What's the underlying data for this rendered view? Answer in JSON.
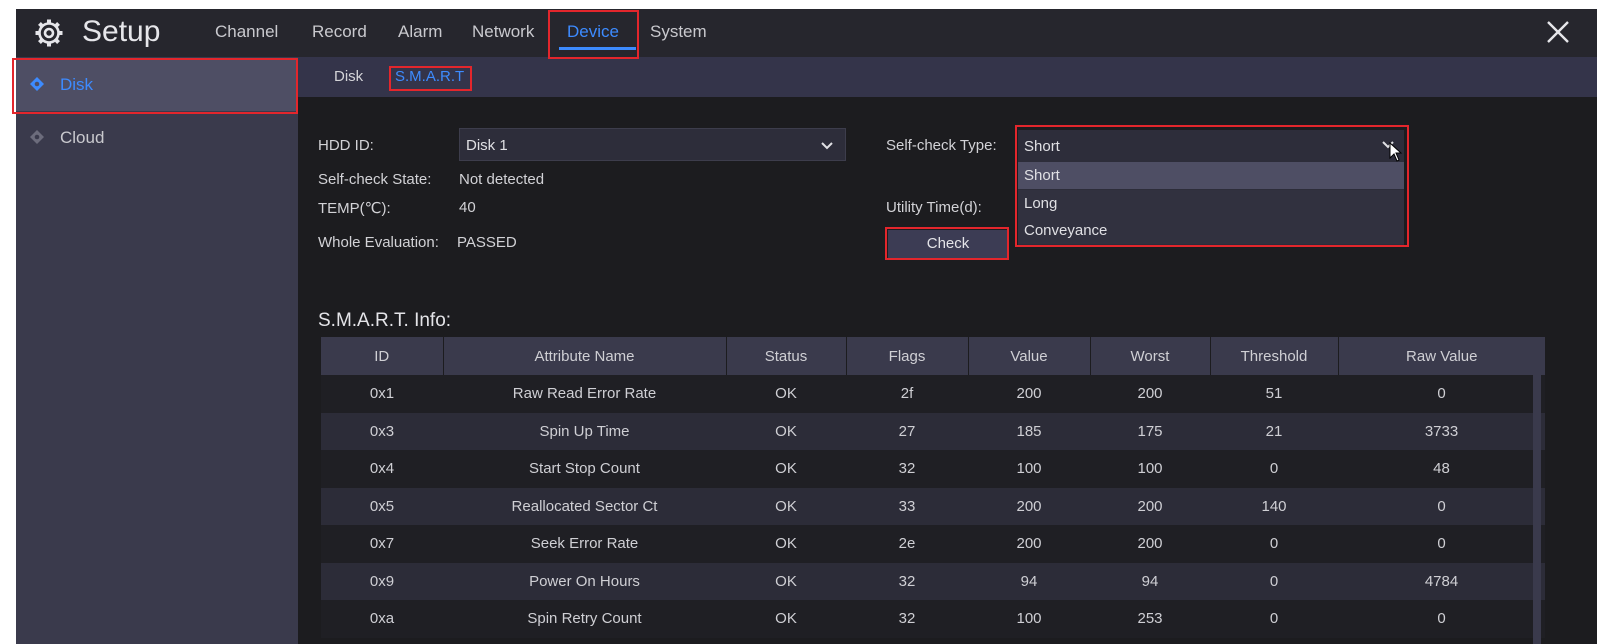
{
  "header": {
    "title": "Setup",
    "tabs": [
      "Channel",
      "Record",
      "Alarm",
      "Network",
      "Device",
      "System"
    ],
    "active_tab": "Device"
  },
  "sidebar": {
    "items": [
      {
        "label": "Disk",
        "active": true
      },
      {
        "label": "Cloud",
        "active": false
      }
    ]
  },
  "subtabs": [
    "Disk",
    "S.M.A.R.T"
  ],
  "info": {
    "hdd_id_label": "HDD ID:",
    "hdd_id_value": "Disk 1",
    "self_check_state_label": "Self-check State:",
    "self_check_state_value": "Not detected",
    "temp_label": "TEMP(℃):",
    "temp_value": "40",
    "whole_eval_label": "Whole Evaluation:",
    "whole_eval_value": "PASSED",
    "self_check_type_label": "Self-check Type:",
    "self_check_type_value": "Short",
    "self_check_type_options": [
      "Short",
      "Long",
      "Conveyance"
    ],
    "utility_time_label": "Utility Time(d):",
    "check_button": "Check"
  },
  "smart": {
    "title": "S.M.A.R.T. Info:",
    "columns": [
      "ID",
      "Attribute Name",
      "Status",
      "Flags",
      "Value",
      "Worst",
      "Threshold",
      "Raw Value"
    ],
    "rows": [
      [
        "0x1",
        "Raw Read Error Rate",
        "OK",
        "2f",
        "200",
        "200",
        "51",
        "0"
      ],
      [
        "0x3",
        "Spin Up Time",
        "OK",
        "27",
        "185",
        "175",
        "21",
        "3733"
      ],
      [
        "0x4",
        "Start Stop Count",
        "OK",
        "32",
        "100",
        "100",
        "0",
        "48"
      ],
      [
        "0x5",
        "Reallocated Sector Ct",
        "OK",
        "33",
        "200",
        "200",
        "140",
        "0"
      ],
      [
        "0x7",
        "Seek Error Rate",
        "OK",
        "2e",
        "200",
        "200",
        "0",
        "0"
      ],
      [
        "0x9",
        "Power On Hours",
        "OK",
        "32",
        "94",
        "94",
        "0",
        "4784"
      ],
      [
        "0xa",
        "Spin Retry Count",
        "OK",
        "32",
        "100",
        "253",
        "0",
        "0"
      ]
    ]
  },
  "colors": {
    "accent": "#3d8bff",
    "highlight": "#e3262c",
    "background": "#1c1c1f"
  }
}
